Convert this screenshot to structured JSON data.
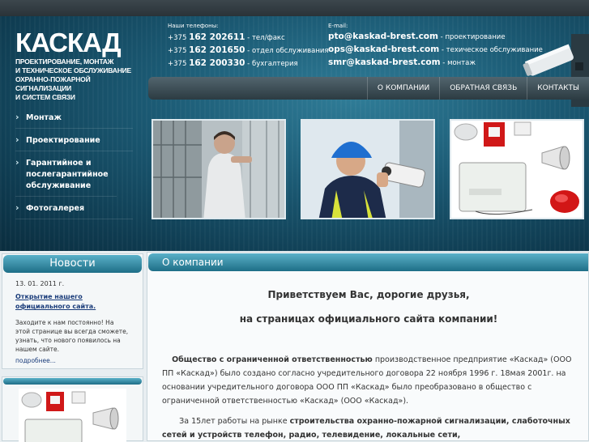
{
  "logo": {
    "brand": "КАСКАД",
    "tagline_lines": [
      "ПРОЕКТИРОВАНИЕ, МОНТАЖ",
      "И ТЕХНИЧЕСКОЕ ОБСЛУЖИВАНИЕ",
      "ОХРАННО-ПОЖАРНОЙ СИГНАЛИЗАЦИИ",
      "И СИСТЕМ СВЯЗИ"
    ]
  },
  "phones": {
    "label": "Наши телефоны:",
    "rows": [
      {
        "prefix": "+375 ",
        "number": "162 202611",
        "note": " - тел/факс"
      },
      {
        "prefix": "+375 ",
        "number": "162 201650",
        "note": " - отдел обслуживания"
      },
      {
        "prefix": "+375 ",
        "number": "162 200330",
        "note": " - бухгалтерия"
      }
    ]
  },
  "emails": {
    "label": "E-mail:",
    "rows": [
      {
        "address": "pto@kaskad-brest.com",
        "note": " - проектирование"
      },
      {
        "address": "ops@kaskad-brest.com",
        "note": " - техическое обслуживание"
      },
      {
        "address": "smr@kaskad-brest.com",
        "note": " - монтаж"
      }
    ]
  },
  "nav": [
    "О КОМПАНИИ",
    "ОБРАТНАЯ СВЯЗЬ",
    "КОНТАКТЫ"
  ],
  "sidemenu": [
    "Монтаж",
    "Проектирование",
    "Гарантийное и послегарантийное обслуживание",
    "Фотогалерея"
  ],
  "news": {
    "heading": "Новости",
    "date": "13. 01. 2011 г.",
    "title": "Открытие нашего официального сайта.",
    "text": "Заходите к нам постоянно! На этой странице вы всегда сможете, узнать, что нового появилось на нашем сайте.",
    "more": "подробнее..."
  },
  "main": {
    "heading": "О компании",
    "greeting_line1": "Приветствуем Вас, дорогие друзья,",
    "greeting_line2": "на страницах официального сайта компании!",
    "para1_bold": "Общество с ограниченной ответственностью",
    "para1_rest": "             производственное предприятие «Каскад» (ООО ПП «Каскад») было создано согласно учредительного договора 22 ноября 1996 г.  18мая  2001г. на основании учредительного договора ООО ПП  «Каскад» было преобразовано в общество с ограниченной ответственностью «Каскад» (ООО «Каскад»).",
    "para2_start": "За  15лет работы на рынке                ",
    "para2_bold": "строительства охранно-пожарной сигнализации, слаботочных сетей и устройств  телефон, радио, телевидение, локальные сети,"
  },
  "colors": {
    "header_dark": "#0e3a4f",
    "header_mid": "#2f7c97",
    "panel_head": "#1e6e87",
    "link": "#1a3c7a"
  }
}
